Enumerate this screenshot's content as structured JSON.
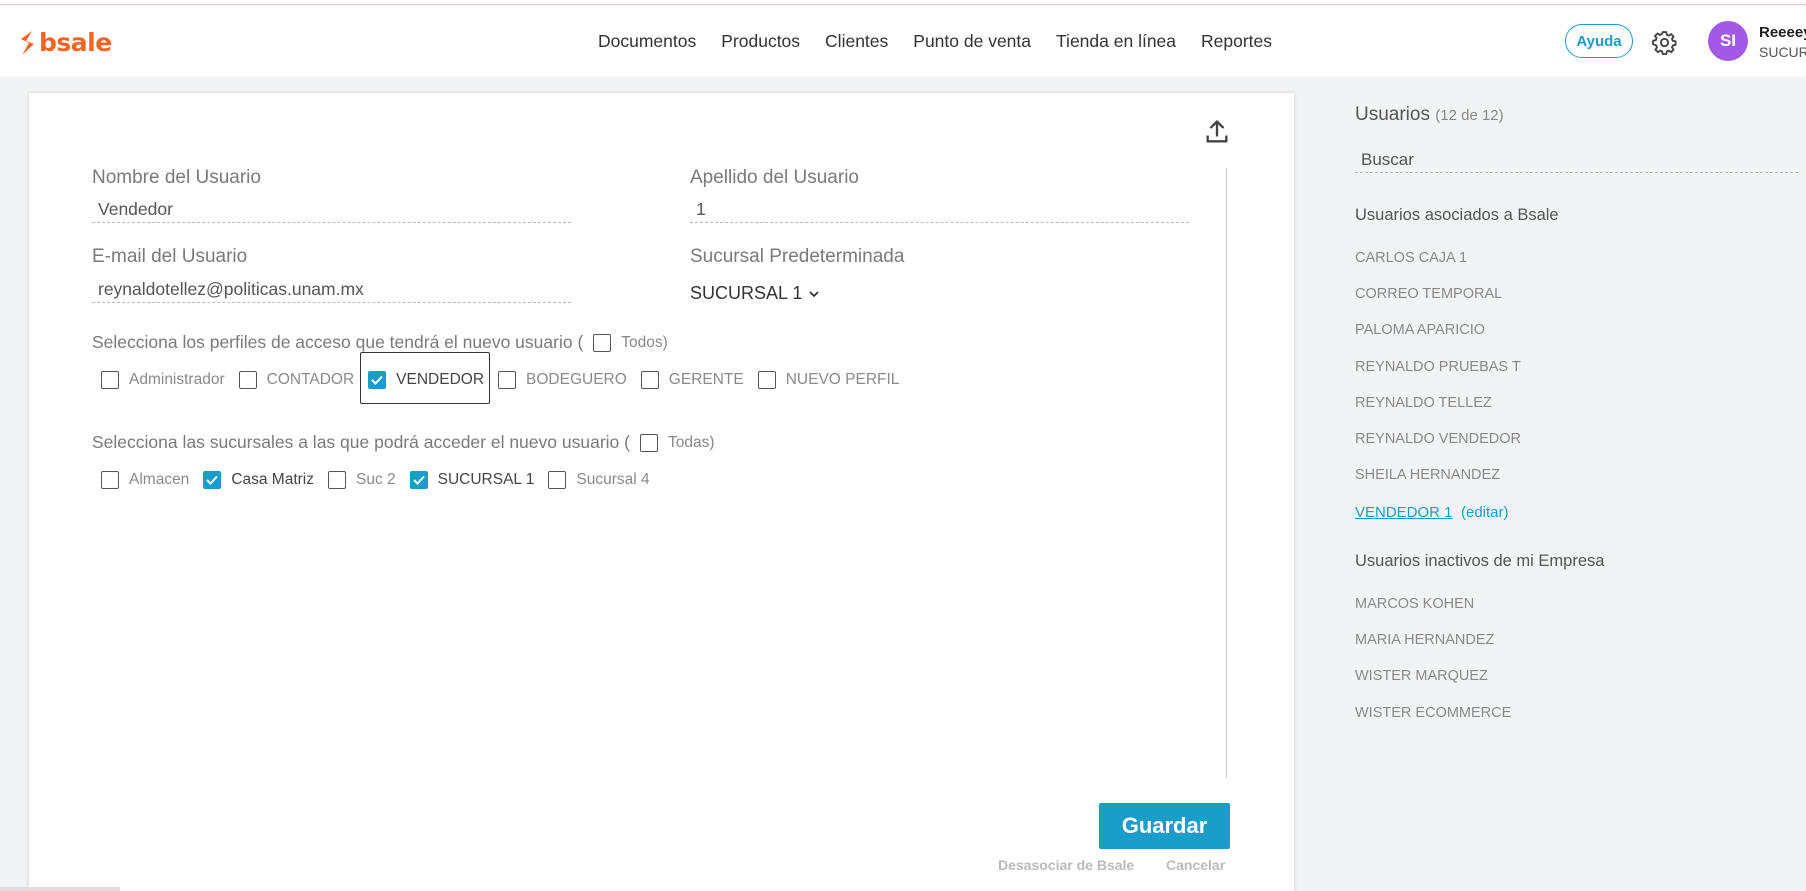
{
  "brand": {
    "name": "bsale",
    "accent": "#f26522",
    "primary": "#1a9dc9"
  },
  "nav": [
    "Documentos",
    "Productos",
    "Clientes",
    "Punto de venta",
    "Tienda en línea",
    "Reportes"
  ],
  "header": {
    "help_label": "Ayuda",
    "avatar_initials": "SI",
    "user_name": "Reeeey",
    "user_branch": "SUCUR"
  },
  "form": {
    "first_name_label": "Nombre del Usuario",
    "first_name_value": "Vendedor",
    "last_name_label": "Apellido del Usuario",
    "last_name_value": "1",
    "email_label": "E-mail del Usuario",
    "email_value": "reynaldotellez@politicas.unam.mx",
    "branch_label": "Sucursal Predeterminada",
    "branch_value": "SUCURSAL 1",
    "profiles_question": "Selecciona los perfiles de acceso que tendrá el nuevo usuario (",
    "profiles_all_label": "Todos)",
    "profiles": [
      {
        "label": "Administrador",
        "checked": false
      },
      {
        "label": "CONTADOR",
        "checked": false
      },
      {
        "label": "VENDEDOR",
        "checked": true
      },
      {
        "label": "BODEGUERO",
        "checked": false
      },
      {
        "label": "GERENTE",
        "checked": false
      },
      {
        "label": "NUEVO PERFIL",
        "checked": false
      }
    ],
    "branches_question": "Selecciona las sucursales a las que podrá acceder el nuevo usuario (",
    "branches_all_label": "Todas)",
    "branches": [
      {
        "label": "Almacen",
        "checked": false
      },
      {
        "label": "Casa Matriz",
        "checked": true
      },
      {
        "label": "Suc 2",
        "checked": false
      },
      {
        "label": "SUCURSAL 1",
        "checked": true
      },
      {
        "label": "Sucursal 4",
        "checked": false
      }
    ],
    "save_label": "Guardar",
    "disassociate_label": "Desasociar de Bsale",
    "cancel_label": "Cancelar"
  },
  "users_panel": {
    "title": "Usuarios",
    "count": "(12 de 12)",
    "search_placeholder": "Buscar",
    "associated_heading": "Usuarios asociados a Bsale",
    "associated": [
      "CARLOS CAJA 1",
      "CORREO TEMPORAL",
      "PALOMA APARICIO",
      "REYNALDO PRUEBAS T",
      "REYNALDO TELLEZ",
      "REYNALDO VENDEDOR",
      "SHEILA HERNANDEZ"
    ],
    "current_user": "VENDEDOR 1",
    "edit_label": "(editar)",
    "inactive_heading": "Usuarios inactivos de mi Empresa",
    "inactive": [
      "MARCOS KOHEN",
      "MARIA HERNANDEZ",
      "WISTER MARQUEZ",
      "WISTER ECOMMERCE"
    ]
  }
}
